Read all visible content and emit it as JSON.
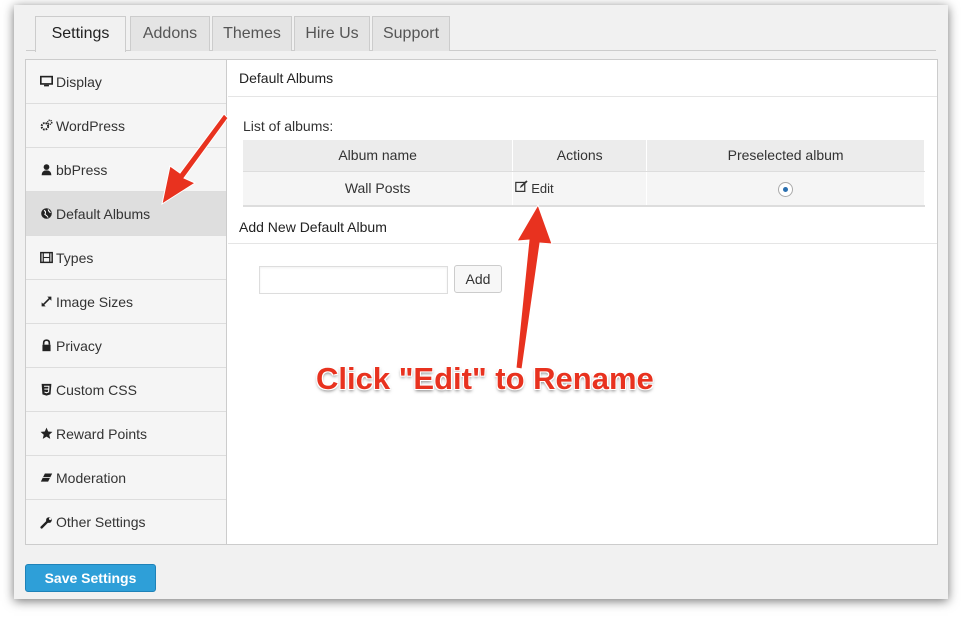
{
  "tabs": [
    {
      "label": "Settings",
      "active": true
    },
    {
      "label": "Addons",
      "active": false
    },
    {
      "label": "Themes",
      "active": false
    },
    {
      "label": "Hire Us",
      "active": false
    },
    {
      "label": "Support",
      "active": false
    }
  ],
  "sidebar": {
    "items": [
      {
        "label": "Display",
        "icon": "monitor-icon"
      },
      {
        "label": "WordPress",
        "icon": "gears-icon"
      },
      {
        "label": "bbPress",
        "icon": "user-icon"
      },
      {
        "label": "Default Albums",
        "icon": "globe-icon",
        "active": true
      },
      {
        "label": "Types",
        "icon": "film-icon"
      },
      {
        "label": "Image Sizes",
        "icon": "resize-icon"
      },
      {
        "label": "Privacy",
        "icon": "lock-icon"
      },
      {
        "label": "Custom CSS",
        "icon": "css3-icon"
      },
      {
        "label": "Reward Points",
        "icon": "star-icon"
      },
      {
        "label": "Moderation",
        "icon": "eraser-icon"
      },
      {
        "label": "Other Settings",
        "icon": "wrench-icon"
      }
    ]
  },
  "main": {
    "title": "Default Albums",
    "list_label": "List of albums:",
    "table": {
      "headers": [
        "Album name",
        "Actions",
        "Preselected album"
      ],
      "rows": [
        {
          "album_name": "Wall Posts",
          "action": "Edit",
          "preselected": true
        }
      ]
    },
    "add_section_title": "Add New Default Album",
    "add_input": {
      "value": "",
      "placeholder": ""
    },
    "add_button": "Add"
  },
  "footer": {
    "save_button": "Save Settings"
  },
  "annotation": {
    "text": "Click \"Edit\" to Rename",
    "color": "#e8321f"
  },
  "colors": {
    "save_button": "#2e9fd8",
    "annotation_red": "#e8321f"
  }
}
